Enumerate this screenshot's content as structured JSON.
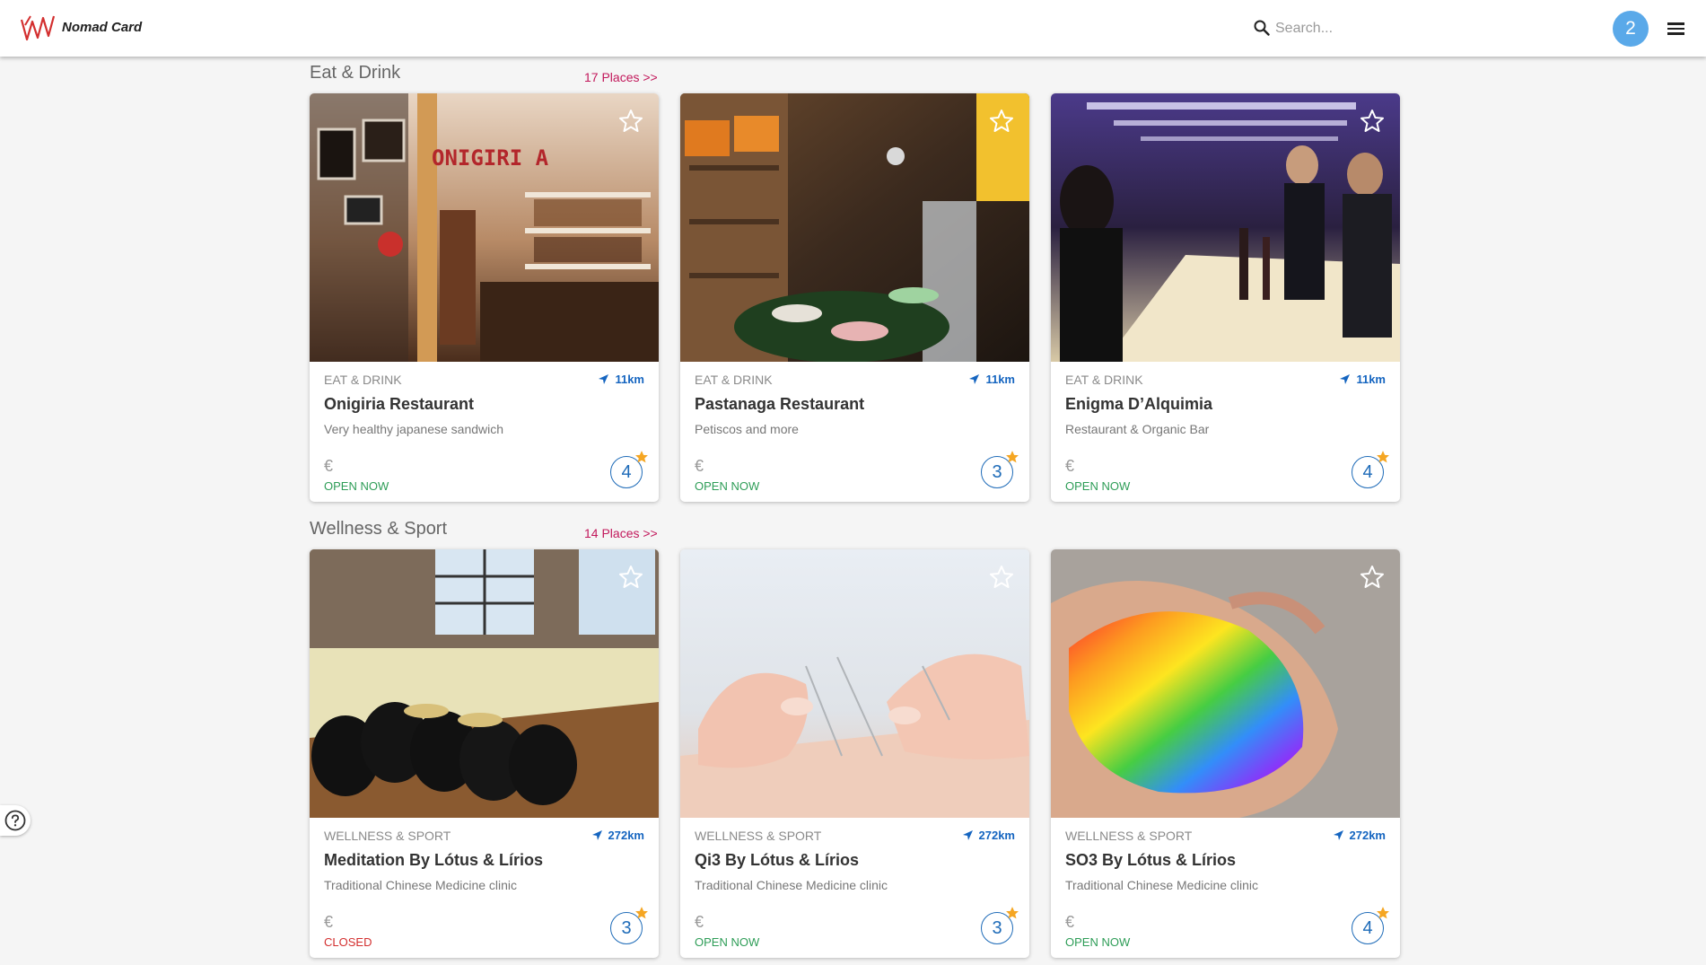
{
  "app": {
    "brand": "Nomad Card"
  },
  "header": {
    "search_placeholder": "Search...",
    "notification_count": "2"
  },
  "sections": [
    {
      "title": "Eat & Drink",
      "link": "17 Places >>",
      "cards": [
        {
          "category": "EAT & DRINK",
          "distance": "11km",
          "name": "Onigiria Restaurant",
          "description": "Very healthy japanese sandwich",
          "price": "€",
          "status": "OPEN NOW",
          "rating": "4",
          "photo_sign": "ONIGIRI A"
        },
        {
          "category": "EAT & DRINK",
          "distance": "11km",
          "name": "Pastanaga Restaurant",
          "description": "Petiscos and more",
          "price": "€",
          "status": "OPEN NOW",
          "rating": "3"
        },
        {
          "category": "EAT & DRINK",
          "distance": "11km",
          "name": "Enigma D’Alquimia",
          "description": "Restaurant & Organic Bar",
          "price": "€",
          "status": "OPEN NOW",
          "rating": "4"
        }
      ]
    },
    {
      "title": "Wellness & Sport",
      "link": "14 Places >>",
      "cards": [
        {
          "category": "WELLNESS & SPORT",
          "distance": "272km",
          "name": "Meditation By Lótus & Lírios",
          "description": "Traditional Chinese Medicine clinic",
          "price": "€",
          "status": "CLOSED",
          "rating": "3"
        },
        {
          "category": "WELLNESS & SPORT",
          "distance": "272km",
          "name": "Qi3 By Lótus & Lírios",
          "description": "Traditional Chinese Medicine clinic",
          "price": "€",
          "status": "OPEN NOW",
          "rating": "3"
        },
        {
          "category": "WELLNESS & SPORT",
          "distance": "272km",
          "name": "SO3 By Lótus & Lírios",
          "description": "Traditional Chinese Medicine clinic",
          "price": "€",
          "status": "OPEN NOW",
          "rating": "4"
        }
      ]
    }
  ],
  "colors": {
    "accent": "#c2185b",
    "distance": "#1565c0",
    "open": "#2e9d57",
    "closed": "#d32f2f",
    "rating_star": "#f5a623",
    "avatar": "#5aa9e9"
  }
}
